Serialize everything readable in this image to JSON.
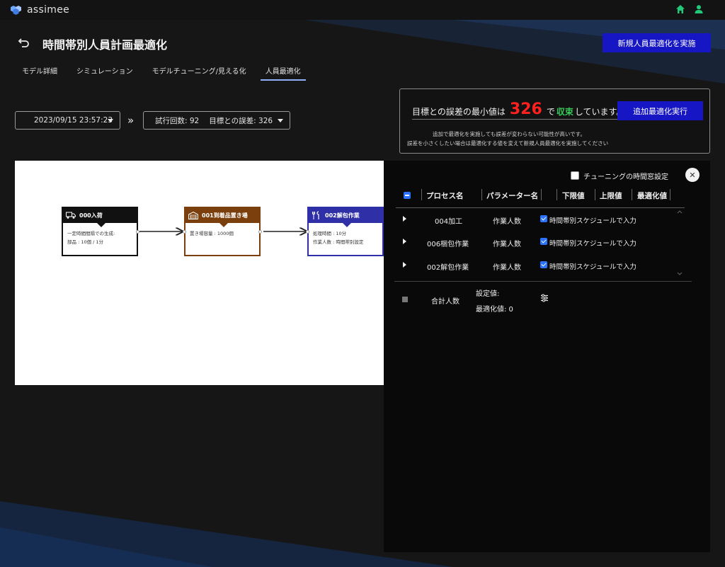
{
  "app": {
    "name": "assimee",
    "logo_icon": "cube-cluster-icon"
  },
  "colors": {
    "accent_blue": "#1616c4",
    "value_red": "#ff2020",
    "converged_green": "#36c95a",
    "node_entry": "#111111",
    "node_storage": "#7a3f0d",
    "node_work": "#2f2fa8",
    "top_icon_green": "#22c97a"
  },
  "topbar": {
    "icons": [
      "home-icon",
      "user-icon"
    ]
  },
  "header": {
    "title": "時間帯別人員計画最適化",
    "new_button": "新規人員最適化を実施"
  },
  "tabs": [
    {
      "label": "モデル詳細",
      "active": false
    },
    {
      "label": "シミュレーション",
      "active": false
    },
    {
      "label": "モデルチューニング/見える化",
      "active": false
    },
    {
      "label": "人員最適化",
      "active": true
    }
  ],
  "selectors": {
    "date": "2023/09/15 23:57:23",
    "trial_label": "試行回数: 92",
    "error_label": "目標との誤差: 326"
  },
  "status": {
    "prefix": "目標との誤差の最小値は",
    "value": "326",
    "mid": "で",
    "converged": "収束",
    "suffix": "しています。",
    "note1": "追加で最適化を実施しても誤差が変わらない可能性が高いです。",
    "note2": "誤差を小さくしたい場合は最適化する値を変えて新規人員最適化を実施してください",
    "add_button": "追加最適化実行"
  },
  "nodes": [
    {
      "title": "000入荷",
      "icon": "truck-icon",
      "lines": [
        "一定時間間隔での生成:",
        "部品 : 10個 / 1分"
      ]
    },
    {
      "title": "001到着品置き場",
      "icon": "warehouse-icon",
      "lines": [
        "置き場容量 : 1000個"
      ]
    },
    {
      "title": "002解包作業",
      "icon": "tools-icon",
      "lines": [
        "処理時間 : 10分",
        "作業人数 : 時間帯別設定"
      ]
    }
  ],
  "panel": {
    "tuning_label": "チューニングの時間窓設定",
    "columns": [
      "プロセス名",
      "パラメーター名",
      "下限値",
      "上限値",
      "最適化値"
    ],
    "rows": [
      {
        "process": "004加工",
        "param": "作業人数",
        "option": "時間帯別スケジュールで入力"
      },
      {
        "process": "006梱包作業",
        "param": "作業人数",
        "option": "時間帯別スケジュールで入力"
      },
      {
        "process": "002解包作業",
        "param": "作業人数",
        "option": "時間帯別スケジュールで入力"
      }
    ],
    "summary": {
      "label": "合計人数",
      "setting": "設定値:",
      "optimized": "最適化値: 0"
    }
  }
}
